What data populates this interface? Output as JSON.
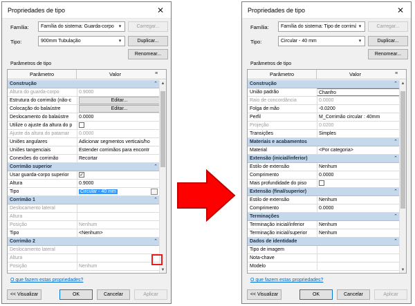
{
  "left_dialog": {
    "title": "Propriedades de tipo",
    "familia_label": "Família:",
    "familia_value": "Família do sistema: Guarda-corpo",
    "carregar": "Carregar...",
    "tipo_label": "Tipo:",
    "tipo_value": "900mm Tubulação",
    "duplicar": "Duplicar...",
    "renomear": "Renomear...",
    "params_label": "Parâmetros de tipo",
    "col_param": "Parâmetro",
    "col_valor": "Valor",
    "rows": [
      {
        "k": "Construção",
        "section": true
      },
      {
        "k": "Altura do guarda-corpo",
        "v": "0.9000",
        "grey": true
      },
      {
        "k": "Estrutura do corrimão (não-c",
        "v": "Editar...",
        "button": true
      },
      {
        "k": "Colocação do balaústre",
        "v": "Editar...",
        "button": true
      },
      {
        "k": "Deslocamento do balaústre",
        "v": "0.0000"
      },
      {
        "k": "Utilize o ajuste da altura do p",
        "v": "",
        "check": true
      },
      {
        "k": "Ajuste da altura do patamar",
        "v": "0.0000",
        "grey": true
      },
      {
        "k": "Uniões angulares",
        "v": "Adicionar segmentos verticais/ho"
      },
      {
        "k": "Uniões tangenciais",
        "v": "Estender corrimãos para encontr"
      },
      {
        "k": "Conexões do corrimão",
        "v": "Recortar"
      },
      {
        "k": "Corrimão superior",
        "section": true
      },
      {
        "k": "Usar guarda-corpo superior",
        "v": "✓",
        "check": true
      },
      {
        "k": "Altura",
        "v": "0.9000"
      },
      {
        "k": "Tipo",
        "v": "Circular - 40 mm",
        "selected": true
      },
      {
        "k": "Corrimão 1",
        "section": true
      },
      {
        "k": "Deslocamento lateral",
        "v": "",
        "grey": true
      },
      {
        "k": "Altura",
        "v": "",
        "grey": true
      },
      {
        "k": "Posição",
        "v": "Nenhum",
        "grey": true
      },
      {
        "k": "Tipo",
        "v": "<Nenhum>"
      },
      {
        "k": "Corrimão 2",
        "section": true
      },
      {
        "k": "Deslocamento lateral",
        "v": "",
        "grey": true
      },
      {
        "k": "Altura",
        "v": "",
        "grey": true
      },
      {
        "k": "Posição",
        "v": "Nenhum",
        "grey": true
      }
    ],
    "help_link": "O que fazem estas propriedades?",
    "visualizar": "<< Visualizar",
    "ok": "OK",
    "cancelar": "Cancelar",
    "aplicar": "Aplicar"
  },
  "right_dialog": {
    "title": "Propriedades de tipo",
    "familia_label": "Família:",
    "familia_value": "Família do sistema: Tipo de corrimão s",
    "carregar": "Carregar...",
    "tipo_label": "Tipo:",
    "tipo_value": "Circular - 40 mm",
    "duplicar": "Duplicar...",
    "renomear": "Renomear...",
    "params_label": "Parâmetros de tipo",
    "col_param": "Parâmetro",
    "col_valor": "Valor",
    "rows": [
      {
        "k": "Construção",
        "section": true
      },
      {
        "k": "União padrão",
        "v": "Chanfro",
        "boxed": true
      },
      {
        "k": "Raio de concordância",
        "v": "0.0000",
        "grey": true
      },
      {
        "k": "Folga de mão",
        "v": "-0.0200"
      },
      {
        "k": "Perfil",
        "v": "M_Corrimão circular : 40mm"
      },
      {
        "k": "Projeção",
        "v": "0.0200",
        "grey": true
      },
      {
        "k": "Transições",
        "v": "Simples"
      },
      {
        "k": "Materiais e acabamentos",
        "section": true
      },
      {
        "k": "Material",
        "v": "<Por categoria>"
      },
      {
        "k": "Extensão (inicial/inferior)",
        "section": true
      },
      {
        "k": "Estilo de extensão",
        "v": "Nenhum"
      },
      {
        "k": "Comprimento",
        "v": "0.0000"
      },
      {
        "k": "Mais profundidade do piso",
        "v": "",
        "check": true
      },
      {
        "k": "Extensão (final/superior)",
        "section": true
      },
      {
        "k": "Estilo de extensão",
        "v": "Nenhum"
      },
      {
        "k": "Comprimento",
        "v": "0.0000"
      },
      {
        "k": "Terminações",
        "section": true
      },
      {
        "k": "Terminação inicial/inferior",
        "v": "Nenhum"
      },
      {
        "k": "Terminação inicial/superior",
        "v": "Nenhum"
      },
      {
        "k": "Dados de identidade",
        "section": true
      },
      {
        "k": "Tipo de imagem",
        "v": ""
      },
      {
        "k": "Nota-chave",
        "v": ""
      },
      {
        "k": "Modelo",
        "v": ""
      }
    ],
    "help_link": "O que fazem estas propriedades?",
    "visualizar": "<< Visualizar",
    "ok": "OK",
    "cancelar": "Cancelar",
    "aplicar": "Aplicar"
  },
  "colors": {
    "section_bg": "#c6d9ec",
    "highlight_red": "#e81c1c",
    "selection_blue": "#3399ff"
  }
}
